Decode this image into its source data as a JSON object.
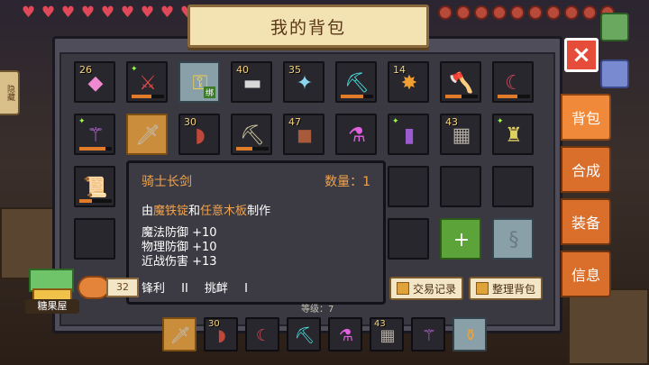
{
  "hud": {
    "hearts": [
      "heart",
      "heart",
      "heart",
      "heart",
      "heart",
      "heart",
      "heart",
      "heart",
      "heart",
      "heart"
    ],
    "food": [
      "food",
      "food",
      "food",
      "food",
      "food",
      "food",
      "food",
      "food",
      "food",
      "food"
    ]
  },
  "side_tab_left": "隐藏",
  "title": "我的背包",
  "close_icon": "×",
  "tabs": [
    {
      "label": "背包",
      "active": true
    },
    {
      "label": "合成",
      "active": false
    },
    {
      "label": "装备",
      "active": false
    },
    {
      "label": "信息",
      "active": false
    }
  ],
  "inventory": {
    "rows": [
      [
        {
          "count": "26",
          "icon": "gem-icon",
          "glyph": "◆",
          "color": "#f08ad0"
        },
        {
          "count": "",
          "icon": "red-sword-icon",
          "glyph": "⚔",
          "color": "#e04a4a",
          "dur": 0.6,
          "spark": true
        },
        {
          "count": "",
          "icon": "green-lock-icon",
          "glyph": "⚿",
          "color": "#f2d04a",
          "lvl": "绑",
          "bright": true
        },
        {
          "count": "40",
          "icon": "iron-ingot-icon",
          "glyph": "▬",
          "color": "#d8d8d8"
        },
        {
          "count": "35",
          "icon": "blue-dragonfly-icon",
          "glyph": "✦",
          "color": "#8ad6f0"
        },
        {
          "count": "",
          "icon": "diamond-pickaxe-icon",
          "glyph": "⛏",
          "color": "#4ae0e0",
          "dur": 0.7
        },
        {
          "count": "14",
          "icon": "torch-icon",
          "glyph": "✸",
          "color": "#f0a030"
        },
        {
          "count": "",
          "icon": "diamond-axe-icon",
          "glyph": "🪓",
          "color": "#4ac0f0",
          "dur": 0.5
        },
        {
          "count": "",
          "icon": "dark-scythe-icon",
          "glyph": "☾",
          "color": "#d04a5a",
          "dur": 0.6
        }
      ],
      [
        {
          "count": "",
          "icon": "purple-staff-icon",
          "glyph": "⚚",
          "color": "#c070e0",
          "dur": 0.8,
          "spark": true
        },
        {
          "count": "",
          "icon": "knight-sword-icon",
          "glyph": "🗡",
          "color": "#c0c0c0",
          "sel": true
        },
        {
          "count": "30",
          "icon": "meat-icon",
          "glyph": "◗",
          "color": "#c0483a"
        },
        {
          "count": "",
          "icon": "pickaxe-icon",
          "glyph": "⛏",
          "color": "#d0c8a0",
          "dur": 0.5
        },
        {
          "count": "47",
          "icon": "leather-icon",
          "glyph": "◼",
          "color": "#a85a3a"
        },
        {
          "count": "",
          "icon": "potion-icon",
          "glyph": "⚗",
          "color": "#e060e0"
        },
        {
          "count": "",
          "icon": "spellbook-icon",
          "glyph": "▮",
          "color": "#9a5ad0",
          "spark": true
        },
        {
          "count": "43",
          "icon": "stone-block-icon",
          "glyph": "▦",
          "color": "#b0aaa0"
        },
        {
          "count": "",
          "icon": "armor-icon",
          "glyph": "♜",
          "color": "#e0d060",
          "spark": true
        }
      ],
      [
        {
          "count": "",
          "icon": "scroll-map-icon",
          "glyph": "📜",
          "color": "#e0d0a0",
          "dur": 0.4
        },
        {
          "count": "",
          "icon": "",
          "glyph": "",
          "color": ""
        },
        {
          "count": "",
          "icon": "",
          "glyph": "",
          "color": ""
        },
        {
          "count": "",
          "icon": "",
          "glyph": "",
          "color": ""
        },
        {
          "count": "",
          "icon": "",
          "glyph": "",
          "color": ""
        },
        {
          "count": "",
          "icon": "",
          "glyph": "",
          "color": ""
        },
        {
          "count": "",
          "icon": "",
          "glyph": "",
          "color": ""
        },
        {
          "count": "",
          "icon": "",
          "glyph": "",
          "color": ""
        },
        {
          "count": "",
          "icon": "",
          "glyph": "",
          "color": ""
        }
      ],
      [
        {
          "count": "",
          "icon": "",
          "glyph": "",
          "color": ""
        },
        {
          "count": "",
          "icon": "",
          "glyph": "",
          "color": ""
        },
        {
          "count": "",
          "icon": "",
          "glyph": "",
          "color": ""
        },
        {
          "count": "",
          "icon": "",
          "glyph": "",
          "color": ""
        },
        {
          "count": "",
          "icon": "",
          "glyph": "",
          "color": ""
        },
        {
          "count": "",
          "icon": "",
          "glyph": "",
          "color": ""
        },
        {
          "count": "",
          "icon": "",
          "glyph": "",
          "color": ""
        },
        {
          "count": "",
          "icon": "add-slot-icon",
          "glyph": "+",
          "color": "#ffffff",
          "green": true
        },
        {
          "count": "",
          "icon": "rune-stone-icon",
          "glyph": "§",
          "color": "#6a7a82",
          "bright": true
        }
      ]
    ]
  },
  "tooltip": {
    "name": "骑士长剑",
    "quantity": "数量：1",
    "recipe_prefix": "由",
    "recipe_a": "魔铁锭",
    "recipe_mid": "和",
    "recipe_b": "任意木板",
    "recipe_suffix": "制作",
    "stats": [
      "魔法防御 +10",
      "物理防御 +10",
      "近战伤害 +13"
    ],
    "enchants": "锋利 II 挑衅 I"
  },
  "coins": "32",
  "buttons": {
    "trade_log": "交易记录",
    "sort_bag": "整理背包"
  },
  "candy_house": "糖果屋",
  "level_text": "等级：7",
  "hotbar": [
    {
      "count": "",
      "icon": "knight-sword-icon",
      "glyph": "🗡",
      "color": "#c0c0c0",
      "sel": true
    },
    {
      "count": "30",
      "icon": "meat-icon",
      "glyph": "◗",
      "color": "#c0483a"
    },
    {
      "count": "",
      "icon": "dark-scythe-icon",
      "glyph": "☾",
      "color": "#d04a5a"
    },
    {
      "count": "",
      "icon": "diamond-pickaxe-icon",
      "glyph": "⛏",
      "color": "#4ae0e0"
    },
    {
      "count": "",
      "icon": "potion-icon",
      "glyph": "⚗",
      "color": "#e060e0"
    },
    {
      "count": "43",
      "icon": "stone-block-icon",
      "glyph": "▦",
      "color": "#b0aaa0"
    },
    {
      "count": "",
      "icon": "purple-staff-icon",
      "glyph": "⚚",
      "color": "#c070e0"
    },
    {
      "count": "",
      "icon": "honey-jar-icon",
      "glyph": "⚱",
      "color": "#f0a030",
      "bright": true
    }
  ]
}
